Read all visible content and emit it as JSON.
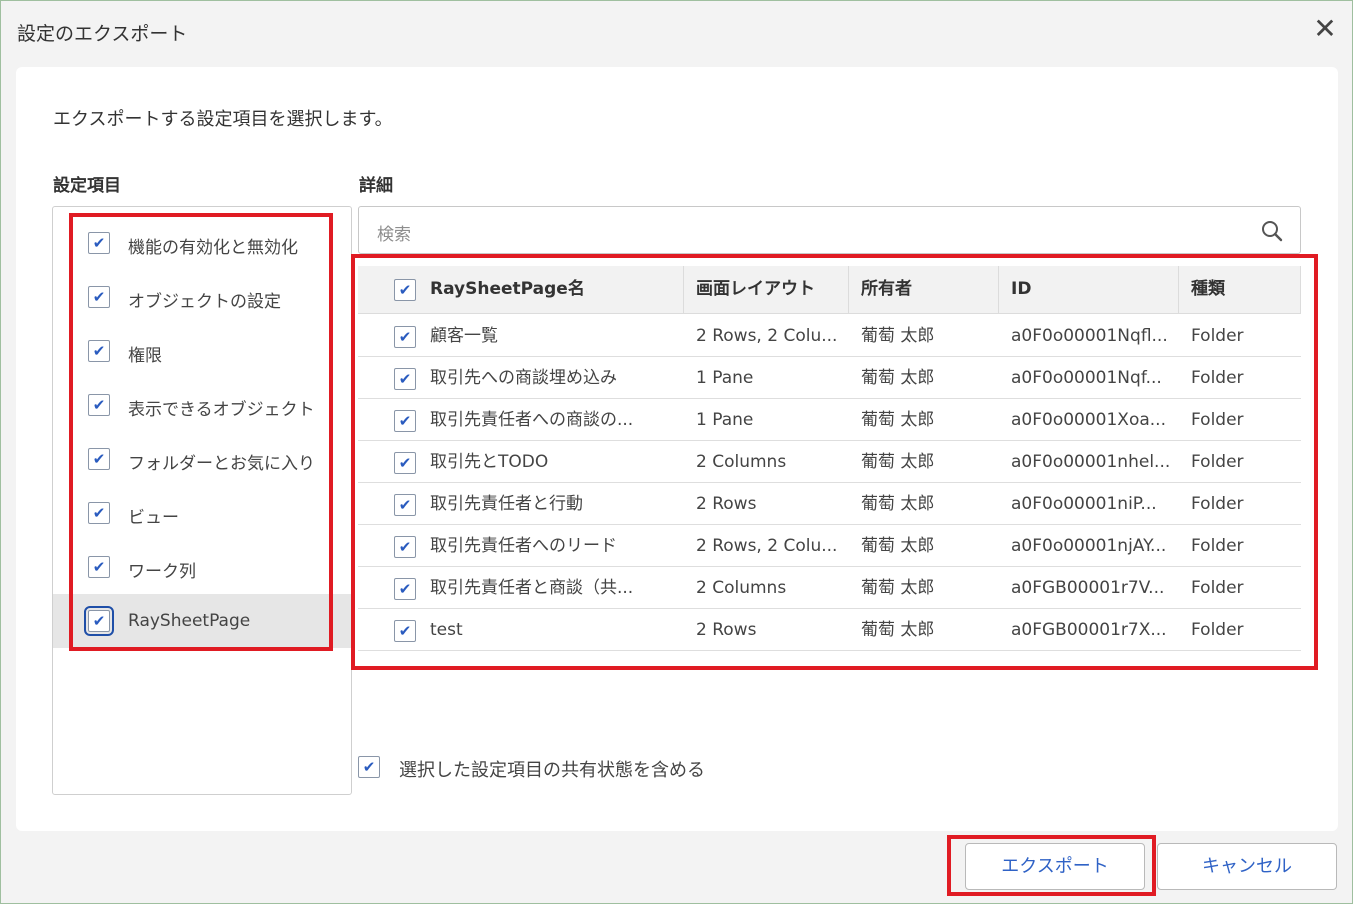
{
  "dialog": {
    "title": "設定のエクスポート",
    "close_label": "✕"
  },
  "description": "エクスポートする設定項目を選択します。",
  "left": {
    "label": "設定項目",
    "items": [
      {
        "label": "機能の有効化と無効化",
        "checked": true
      },
      {
        "label": "オブジェクトの設定",
        "checked": true
      },
      {
        "label": "権限",
        "checked": true
      },
      {
        "label": "表示できるオブジェクト",
        "checked": true
      },
      {
        "label": "フォルダーとお気に入り",
        "checked": true
      },
      {
        "label": "ビュー",
        "checked": true
      },
      {
        "label": "ワーク列",
        "checked": true
      },
      {
        "label": "RaySheetPage",
        "checked": true
      }
    ]
  },
  "detail": {
    "label": "詳細",
    "search_placeholder": "検索",
    "columns": [
      "RaySheetPage名",
      "画面レイアウト",
      "所有者",
      "ID",
      "種類"
    ],
    "rows": [
      [
        "顧客一覧",
        "2 Rows, 2 Colu...",
        "葡萄 太郎",
        "a0F0o00001Nqfl...",
        "Folder"
      ],
      [
        "取引先への商談埋め込み",
        "1 Pane",
        "葡萄 太郎",
        "a0F0o00001Nqf...",
        "Folder"
      ],
      [
        "取引先責任者への商談の...",
        "1 Pane",
        "葡萄 太郎",
        "a0F0o00001Xoa...",
        "Folder"
      ],
      [
        "取引先とTODO",
        "2 Columns",
        "葡萄 太郎",
        "a0F0o00001nhel...",
        "Folder"
      ],
      [
        "取引先責任者と行動",
        "2 Rows",
        "葡萄 太郎",
        "a0F0o00001niP...",
        "Folder"
      ],
      [
        "取引先責任者へのリード",
        "2 Rows, 2 Colu...",
        "葡萄 太郎",
        "a0F0o00001njAY...",
        "Folder"
      ],
      [
        "取引先責任者と商談（共...",
        "2 Columns",
        "葡萄 太郎",
        "a0FGB00001r7V...",
        "Folder"
      ],
      [
        "test",
        "2 Rows",
        "葡萄 太郎",
        "a0FGB00001r7X...",
        "Folder"
      ]
    ]
  },
  "share_option": {
    "label": "選択した設定項目の共有状態を含める",
    "checked": true
  },
  "buttons": {
    "export": "エクスポート",
    "cancel": "キャンセル"
  },
  "checkmark": "✔",
  "colors": {
    "highlight": "#e01b23",
    "accent": "#2f62c6"
  }
}
